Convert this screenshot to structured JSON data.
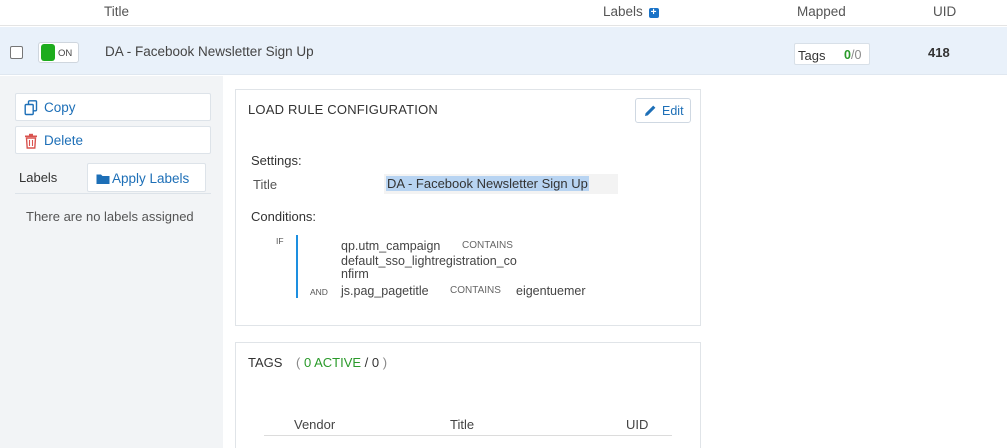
{
  "table_header": {
    "title": "Title",
    "labels": "Labels",
    "labels_add_icon": "plus-icon",
    "mapped": "Mapped",
    "uid": "UID"
  },
  "rule": {
    "toggle_label": "ON",
    "toggle_color": "#1dac1d",
    "title": "DA - Facebook Newsletter Sign Up",
    "tags_label": "Tags",
    "tags_active": "0",
    "tags_sep": "/",
    "tags_total": "0",
    "uid": "418"
  },
  "actions": {
    "copy": "Copy",
    "delete": "Delete",
    "labels_heading": "Labels",
    "apply_labels": "Apply Labels",
    "no_labels": "There are no labels assigned"
  },
  "load_rule": {
    "heading": "LOAD RULE CONFIGURATION",
    "edit": "Edit",
    "settings_label": "Settings:",
    "setting_key": "Title",
    "setting_value": "DA - Facebook Newsletter Sign Up",
    "conditions_label": "Conditions:",
    "if_label": "IF",
    "and_label": "AND",
    "condition1": {
      "variable": "qp.utm_campaign",
      "operator": "CONTAINS",
      "value_line1": "default_sso_lightregistration_co",
      "value_line2": "nfirm"
    },
    "condition2": {
      "variable": "js.pag_pagetitle",
      "operator": "CONTAINS",
      "value": "eigentuemer"
    }
  },
  "tags_card": {
    "heading": "TAGS",
    "open_paren": "(",
    "active": "0 ACTIVE",
    "sep": " / ",
    "total": "0",
    "close_paren": ")",
    "columns": [
      "Vendor",
      "Title",
      "UID"
    ]
  },
  "colors": {
    "accent": "#1d6fb7",
    "active_green": "#2a9a2a",
    "selected_row": "#e9f1fa",
    "condition_bar": "#1d8fe0"
  }
}
